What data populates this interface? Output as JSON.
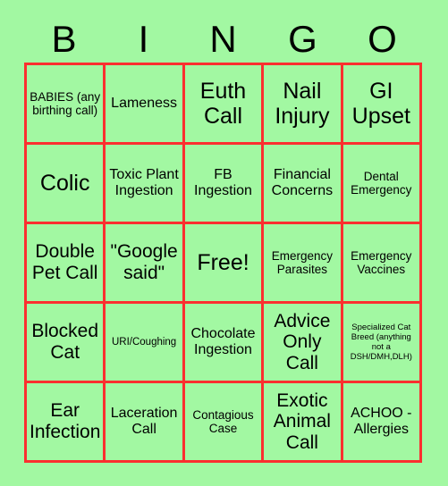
{
  "card": {
    "title_letters": [
      "B",
      "I",
      "N",
      "G",
      "O"
    ],
    "background_color": "#a2f8a2",
    "border_color": "#fb2f2f",
    "text_color": "#000000",
    "rows": 5,
    "columns": 5,
    "free_space_index": 12,
    "cells": [
      {
        "text": "BABIES (any birthing call)",
        "size": "sm"
      },
      {
        "text": "Lameness",
        "size": "md"
      },
      {
        "text": "Euth Call",
        "size": "xl"
      },
      {
        "text": "Nail Injury",
        "size": "xl"
      },
      {
        "text": "GI Upset",
        "size": "xl"
      },
      {
        "text": "Colic",
        "size": "xl"
      },
      {
        "text": "Toxic Plant Ingestion",
        "size": "md"
      },
      {
        "text": "FB Ingestion",
        "size": "md"
      },
      {
        "text": "Financial Concerns",
        "size": "md"
      },
      {
        "text": "Dental Emergency",
        "size": "sm"
      },
      {
        "text": "Double Pet Call",
        "size": "lg"
      },
      {
        "text": "\"Google said\"",
        "size": "lg"
      },
      {
        "text": "Free!",
        "size": "xl"
      },
      {
        "text": "Emergency Parasites",
        "size": "sm"
      },
      {
        "text": "Emergency Vaccines",
        "size": "sm"
      },
      {
        "text": "Blocked Cat",
        "size": "lg"
      },
      {
        "text": "URI/Coughing",
        "size": "xs"
      },
      {
        "text": "Chocolate Ingestion",
        "size": "md"
      },
      {
        "text": "Advice Only Call",
        "size": "lg"
      },
      {
        "text": "Specialized Cat Breed (anything not a DSH/DMH,DLH)",
        "size": "xxs"
      },
      {
        "text": "Ear Infection",
        "size": "lg"
      },
      {
        "text": "Laceration Call",
        "size": "md"
      },
      {
        "text": "Contagious Case",
        "size": "sm"
      },
      {
        "text": "Exotic Animal Call",
        "size": "lg"
      },
      {
        "text": "ACHOO - Allergies",
        "size": "md"
      }
    ]
  }
}
